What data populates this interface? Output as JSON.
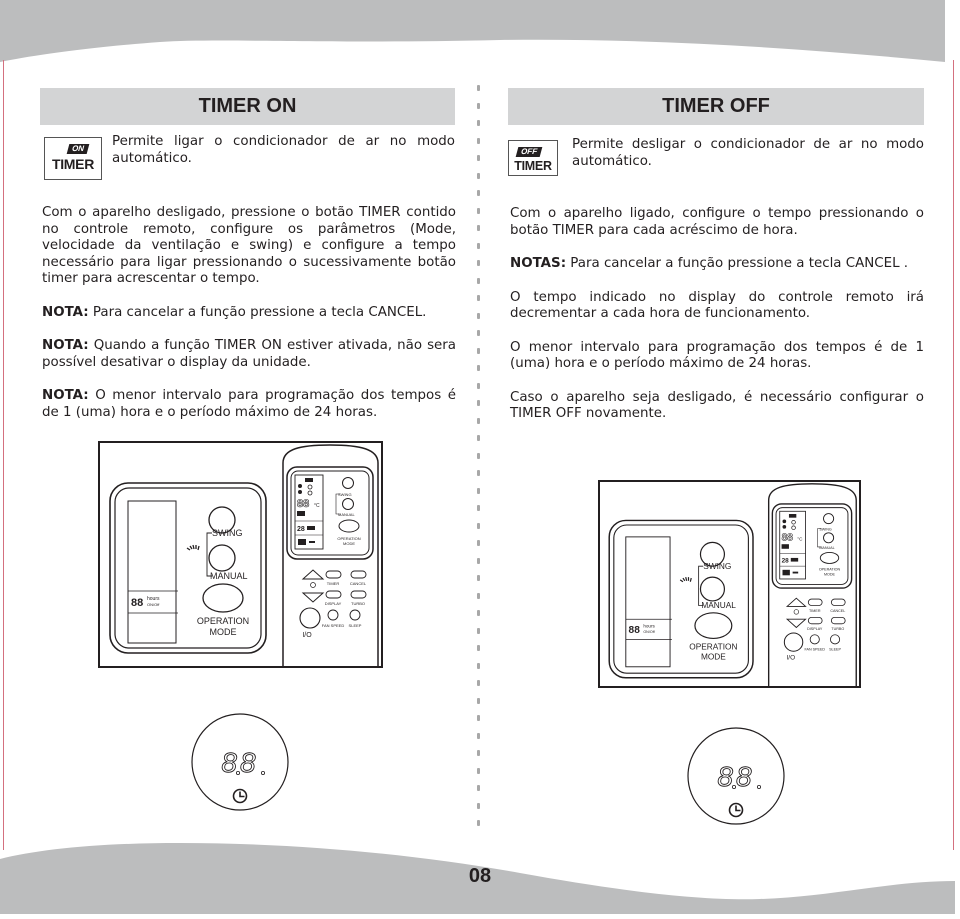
{
  "page": {
    "page_number": "08",
    "colors": {
      "band_gray": "#bcbdbe",
      "header_gray": "#d3d4d5",
      "text": "#231f20",
      "edge_line": "#d4707f"
    }
  },
  "timer_on": {
    "title": "TIMER ON",
    "badge": {
      "tag": "ON",
      "word": "TIMER"
    },
    "intro": "Permite ligar o condicionador de ar no modo automático.",
    "paragraphs": [
      {
        "label": "",
        "text": "Com o aparelho desligado, pressione o botão TIMER contido no controle remoto, configure os parâmetros (Mode, velocidade da ventilação e swing) e configure a tempo necessário para ligar pressionando o sucessivamente botão timer para acrescentar o tempo."
      },
      {
        "label": "NOTA:",
        "text": " Para cancelar a função pressione a tecla CANCEL."
      },
      {
        "label": "NOTA:",
        "text": " Quando a função TIMER ON estiver ativada, não sera possível desativar o display da unidade."
      },
      {
        "label": "NOTA:",
        "text": " O menor intervalo para programação dos tempos é de 1 (uma) hora e o período máximo de 24 horas."
      }
    ]
  },
  "timer_off": {
    "title": "TIMER OFF",
    "badge": {
      "tag": "OFF",
      "word": "TIMER"
    },
    "intro": "Permite desligar o condicionador de ar no modo automático.",
    "paragraphs": [
      {
        "label": "",
        "text": "Com o aparelho ligado, configure o tempo pressionando o botão TIMER para cada acréscimo de hora."
      },
      {
        "label": "NOTAS:",
        "text": " Para cancelar a função pressione a tecla CANCEL ."
      },
      {
        "label": "",
        "text": "O tempo indicado no display do controle remoto irá decrementar a cada hora de funcionamento."
      },
      {
        "label": "",
        "text": "O menor intervalo para programação dos tempos é de 1 (uma) hora e o período máximo de 24 horas."
      },
      {
        "label": "",
        "text": "Caso o aparelho seja desligado, é necessário configurar o TIMER OFF novamente."
      }
    ]
  },
  "remote": {
    "panel_buttons": {
      "swing": "SWING",
      "manual": "MANUAL",
      "operation": "OPERATION",
      "mode": "MODE"
    },
    "panel_display": {
      "digits": "88",
      "hours": "hours",
      "onoff": "ON/Off"
    },
    "handset_buttons": {
      "timer": "TIMER",
      "cancel": "CANCEL",
      "display": "DISPLAY",
      "turbo": "TURBO",
      "fan_speed": "FAN SPEED",
      "sleep": "SLEEP",
      "power": "I/O",
      "swing": "SWING",
      "manual": "MANUAL",
      "operation": "OPERATION",
      "mode": "MODE",
      "lcd_digits": "88",
      "lcd_unit": "°C"
    },
    "timer_display": {
      "digits": "88"
    },
    "icons": [
      "clock-icon",
      "swing-arrow-icon",
      "up-arrow-icon",
      "down-arrow-icon",
      "power-icon"
    ]
  }
}
